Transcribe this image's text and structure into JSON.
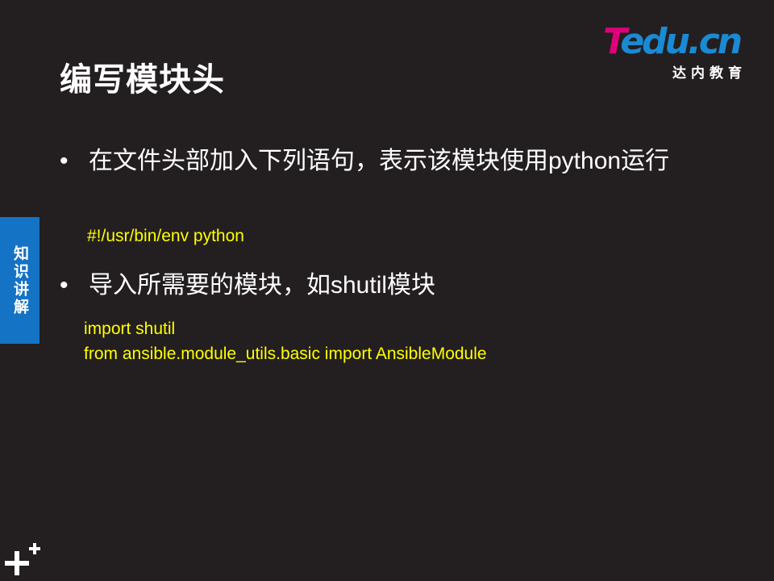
{
  "slide": {
    "title": "编写模块头",
    "side_tab": "知识讲解"
  },
  "logo": {
    "brand_t": "T",
    "brand_rest": "edu.cn",
    "subtitle": "达内教育",
    "colors": {
      "t": "#e0007a",
      "rest": "#1a8ad4"
    }
  },
  "bullets": [
    {
      "marker": "•",
      "text": "在文件头部加入下列语句，表示该模块使用python运行",
      "code": [
        "#!/usr/bin/env python"
      ]
    },
    {
      "marker": "•",
      "text": "导入所需要的模块，如shutil模块",
      "code": [
        "import shutil",
        "from ansible.module_utils.basic import AnsibleModule"
      ]
    }
  ],
  "icons": {
    "corner": "plus-icon"
  },
  "colors": {
    "background": "#231f20",
    "code": "#ffff00",
    "side_tab": "#1473c4"
  }
}
